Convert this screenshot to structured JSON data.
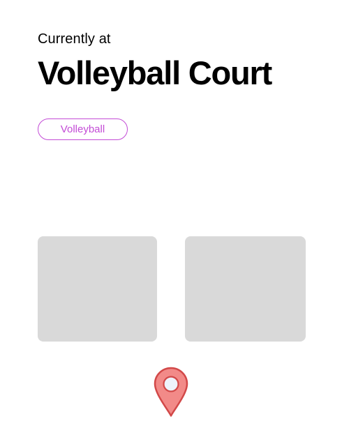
{
  "header": {
    "subtitle": "Currently at",
    "title": "Volleyball Court"
  },
  "tags": [
    {
      "label": "Volleyball",
      "color": "#c34bd6"
    }
  ],
  "cards": [
    {
      "placeholder_color": "#d9d9d9"
    },
    {
      "placeholder_color": "#d9d9d9"
    }
  ],
  "location_pin": {
    "icon": "map-pin-icon",
    "fill": "#f28a88",
    "stroke": "#d24848"
  }
}
